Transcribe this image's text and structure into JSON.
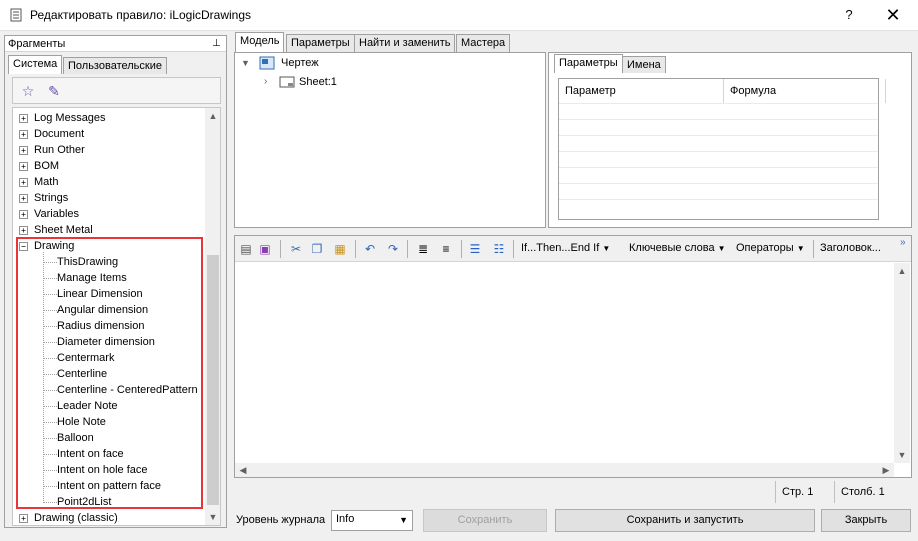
{
  "window": {
    "title": "Редактировать правило: iLogicDrawings",
    "help_label": "?",
    "close_label": "✕"
  },
  "left_panel": {
    "header": "Фрагменты",
    "tabs": [
      "Система",
      "Пользовательские"
    ],
    "active_tab": "Система",
    "tools": [
      "add-favorite-icon",
      "edit-favorite-icon"
    ],
    "tree": [
      {
        "label": "Log Messages",
        "expanded": false
      },
      {
        "label": "Document",
        "expanded": false
      },
      {
        "label": "Run Other",
        "expanded": false
      },
      {
        "label": "BOM",
        "expanded": false
      },
      {
        "label": "Math",
        "expanded": false
      },
      {
        "label": "Strings",
        "expanded": false
      },
      {
        "label": "Variables",
        "expanded": false
      },
      {
        "label": "Sheet Metal",
        "expanded": false
      },
      {
        "label": "Drawing",
        "expanded": true,
        "children": [
          "ThisDrawing",
          "Manage Items",
          "Linear Dimension",
          "Angular dimension",
          "Radius dimension",
          "Diameter dimension",
          "Centermark",
          "Centerline",
          "Centerline - CenteredPattern",
          "Leader Note",
          "Hole Note",
          "Balloon",
          "Intent on face",
          "Intent on hole face",
          "Intent on pattern face",
          "Point2dList"
        ]
      },
      {
        "label": "Drawing (classic)",
        "expanded": false
      }
    ]
  },
  "right_tabs": [
    "Модель",
    "Параметры",
    "Найти и заменить",
    "Мастера"
  ],
  "right_active_tab": "Модель",
  "model_tree": {
    "root": "Чертеж",
    "child": "Sheet:1"
  },
  "params_panel": {
    "tabs": [
      "Параметры",
      "Имена"
    ],
    "active_tab": "Параметры",
    "columns": [
      "Параметр",
      "Формула"
    ]
  },
  "editor_toolbar": {
    "menus": [
      "If...Then...End If",
      "Ключевые слова",
      "Операторы",
      "Заголовок..."
    ],
    "overflow": "»"
  },
  "status": {
    "line": "Стр. 1",
    "column": "Столб. 1"
  },
  "bottom": {
    "log_level_label": "Уровень журнала",
    "log_level_value": "Info",
    "save_label": "Сохранить",
    "save_run_label": "Сохранить и запустить",
    "close_label": "Закрыть"
  }
}
